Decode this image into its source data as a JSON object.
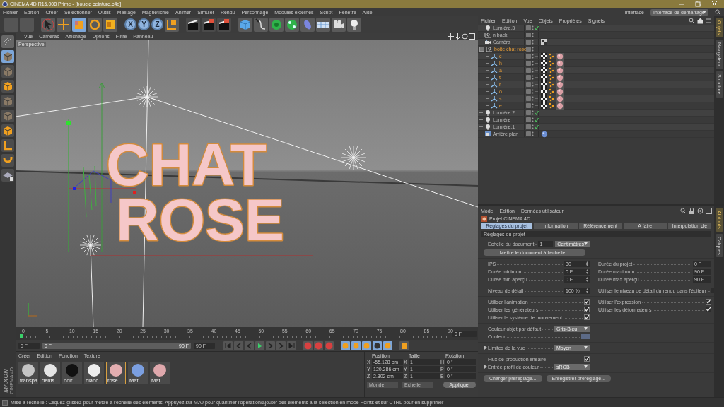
{
  "window": {
    "title": "CINEMA 4D R15.008 Prime - [boucle ceinture.c4d]"
  },
  "menu_bar": {
    "items": [
      "Fichier",
      "Edition",
      "Créer",
      "Sélectionner",
      "Outils",
      "Maillage",
      "Magnétisme",
      "Animer",
      "Simuler",
      "Rendu",
      "Personnage",
      "Modules externes",
      "Script",
      "Fenêtre",
      "Aide"
    ],
    "interface_label": "Interface",
    "interface_value": "Interface de démarrage"
  },
  "toolbar": {
    "tools": [
      {
        "selected": false
      },
      {
        "selected": false
      },
      {
        "selected": true
      },
      {
        "selected": false
      },
      {
        "selected": false
      }
    ],
    "axes": [
      {
        "label": "X"
      },
      {
        "label": "Y"
      },
      {
        "label": "Z"
      }
    ]
  },
  "viewport": {
    "menu": [
      "Vue",
      "Caméras",
      "Affichage",
      "Options",
      "Filtre",
      "Panneau"
    ],
    "camera_label": "Perspective",
    "scene_text": [
      "CHAT",
      "ROSE"
    ]
  },
  "timeline": {
    "ticks": [
      "0",
      "5",
      "10",
      "15",
      "20",
      "25",
      "30",
      "35",
      "40",
      "45",
      "50",
      "55",
      "60",
      "65",
      "70",
      "75",
      "80",
      "85",
      "90"
    ],
    "current_frame": "0 F"
  },
  "transport": {
    "start": "0 F",
    "range_start": "0 F",
    "range_end": "90 F",
    "end": "90 F",
    "level": 1
  },
  "materials": {
    "menu": [
      "Créer",
      "Edition",
      "Fonction",
      "Texture"
    ],
    "logo": [
      "MAXON",
      "CINEMA 4D"
    ],
    "items": [
      {
        "name": "transpa",
        "color": "#c4c4c4",
        "selected": false
      },
      {
        "name": "dents",
        "color": "#e6e6e6",
        "selected": false
      },
      {
        "name": "noir",
        "color": "#111111",
        "selected": false
      },
      {
        "name": "blanc",
        "color": "#eeeeee",
        "selected": false
      },
      {
        "name": "rose",
        "color": "#e3aeb0",
        "selected": true
      },
      {
        "name": "Mat",
        "color": "#7b9fe0",
        "selected": false
      },
      {
        "name": "Mat",
        "color": "#dfa8ac",
        "selected": false
      }
    ]
  },
  "coordinates": {
    "headers": [
      "Position",
      "Taille",
      "Rotation"
    ],
    "rows": [
      {
        "axis": "X",
        "position": "-55.128 cm",
        "size_axis": "X",
        "size": "1",
        "rot_axis": "H",
        "rotation": "0 °"
      },
      {
        "axis": "Y",
        "position": "120.286 cm",
        "size_axis": "Y",
        "size": "1",
        "rot_axis": "P",
        "rotation": "0 °"
      },
      {
        "axis": "Z",
        "position": "2.302 cm",
        "size_axis": "Z",
        "size": "1",
        "rot_axis": "B",
        "rotation": "0 °"
      }
    ],
    "space": "Monde",
    "mode": "Echelle",
    "apply": "Appliquer"
  },
  "object_manager": {
    "menu": [
      "Fichier",
      "Edition",
      "Vue",
      "Objets",
      "Propriétés",
      "Signets"
    ],
    "objects": [
      {
        "name": "Lumière.3",
        "kind": "light",
        "enabled": true,
        "selected": false
      },
      {
        "name": "n back",
        "kind": "null",
        "enabled": false,
        "selected": false
      },
      {
        "name": "Caméra",
        "kind": "camera",
        "enabled": false,
        "selected": false,
        "tags": [
          {
            "kind": "protection"
          }
        ]
      },
      {
        "name": "boite chat rose",
        "kind": "null",
        "enabled": false,
        "selected": true,
        "expanded": true,
        "children": [
          {
            "name": "c",
            "kind": "extrude",
            "enabled": false,
            "selected": true,
            "tags": [
              {
                "kind": "texture"
              },
              {
                "kind": "points"
              },
              {
                "kind": "material"
              }
            ]
          },
          {
            "name": "h",
            "kind": "extrude",
            "enabled": false,
            "selected": true,
            "tags": [
              {
                "kind": "texture"
              },
              {
                "kind": "points"
              },
              {
                "kind": "material"
              }
            ]
          },
          {
            "name": "a",
            "kind": "extrude",
            "enabled": false,
            "selected": true,
            "tags": [
              {
                "kind": "texture"
              },
              {
                "kind": "points"
              },
              {
                "kind": "material"
              }
            ]
          },
          {
            "name": "t",
            "kind": "extrude",
            "enabled": false,
            "selected": true,
            "tags": [
              {
                "kind": "texture"
              },
              {
                "kind": "points"
              },
              {
                "kind": "material"
              }
            ]
          },
          {
            "name": "r",
            "kind": "extrude",
            "enabled": false,
            "selected": true,
            "tags": [
              {
                "kind": "texture"
              },
              {
                "kind": "points"
              },
              {
                "kind": "material"
              }
            ]
          },
          {
            "name": "o",
            "kind": "extrude",
            "enabled": false,
            "selected": true,
            "tags": [
              {
                "kind": "texture"
              },
              {
                "kind": "points"
              },
              {
                "kind": "material"
              }
            ]
          },
          {
            "name": "s",
            "kind": "extrude",
            "enabled": false,
            "selected": true,
            "tags": [
              {
                "kind": "texture"
              },
              {
                "kind": "points"
              },
              {
                "kind": "material"
              }
            ]
          },
          {
            "name": "e",
            "kind": "extrude",
            "enabled": false,
            "selected": true,
            "tags": [
              {
                "kind": "texture"
              },
              {
                "kind": "points"
              },
              {
                "kind": "material"
              }
            ]
          }
        ]
      },
      {
        "name": "Lumière.2",
        "kind": "light",
        "enabled": true,
        "selected": false
      },
      {
        "name": "Lumière",
        "kind": "light",
        "enabled": true,
        "selected": false
      },
      {
        "name": "Lumière.1",
        "kind": "light",
        "enabled": true,
        "selected": false
      },
      {
        "name": "Arrière plan",
        "kind": "background",
        "enabled": false,
        "selected": false,
        "tags": [
          {
            "kind": "material_blue"
          }
        ]
      }
    ]
  },
  "side_tabs_top": [
    {
      "label": "Objets",
      "selected": true
    },
    {
      "label": "Navigateur",
      "selected": false
    },
    {
      "label": "Structure",
      "selected": false
    }
  ],
  "attributes": {
    "menu": [
      "Mode",
      "Edition",
      "Données utilisateur"
    ],
    "title": "Projet CINEMA 4D",
    "tabs": [
      {
        "label": "Réglages du projet",
        "selected": true
      },
      {
        "label": "Information",
        "selected": false
      },
      {
        "label": "Référencement",
        "selected": false
      },
      {
        "label": "A faire",
        "selected": false
      },
      {
        "label": "Interpolation clé",
        "selected": false
      }
    ],
    "section": "Réglages du projet",
    "groups": [
      {
        "left": [
          {
            "label": "Echelle du document",
            "kind": "number_unit",
            "value": "1",
            "unit": "Centimètres"
          }
        ],
        "button": "Mettre le document à l'échelle..."
      },
      {
        "left": [
          {
            "label": "IPS",
            "kind": "number",
            "value": "30"
          },
          {
            "label": "Durée minimum",
            "kind": "number",
            "value": "0 F"
          },
          {
            "label": "Durée min aperçu",
            "kind": "number",
            "value": "0 F"
          }
        ],
        "right": [
          {
            "label": "Durée du projet",
            "kind": "readout",
            "value": "0 F"
          },
          {
            "label": "Durée maximum",
            "kind": "readout",
            "value": "90 F"
          },
          {
            "label": "Durée max aperçu",
            "kind": "readout",
            "value": "90 F"
          }
        ]
      },
      {
        "left": [
          {
            "label": "Niveau de détail",
            "kind": "number",
            "value": "100 %"
          }
        ],
        "right": [
          {
            "label": "Utiliser le niveau de détail du rendu dans l'éditeur",
            "kind": "check",
            "checked": false
          }
        ]
      },
      {
        "left": [
          {
            "label": "Utiliser l'animation",
            "kind": "check",
            "checked": true
          },
          {
            "label": "Utiliser les générateurs",
            "kind": "check",
            "checked": true
          },
          {
            "label": "Utiliser le système de mouvement",
            "kind": "check",
            "checked": true
          }
        ],
        "right": [
          {
            "label": "Utiliser l'expression",
            "kind": "check",
            "checked": true
          },
          {
            "label": "Utiliser les déformateurs",
            "kind": "check",
            "checked": true
          }
        ]
      },
      {
        "left": [
          {
            "label": "Couleur objet par défaut",
            "kind": "dropdown",
            "value": "Gris-Bleu"
          },
          {
            "label": "Couleur",
            "kind": "color",
            "color": "#5c6a86"
          }
        ]
      },
      {
        "left": [
          {
            "label": "Limites de la vue",
            "kind": "dropdown",
            "value": "Moyen",
            "expanded": false
          }
        ]
      },
      {
        "left": [
          {
            "label": "Flux de production linéaire",
            "kind": "check",
            "checked": true
          },
          {
            "label": "Entrée profil de couleur",
            "kind": "dropdown",
            "value": "sRGB",
            "expanded": false
          }
        ]
      }
    ],
    "presets": [
      "Charger préréglage...",
      "Enregistrer préréglage..."
    ]
  },
  "side_tabs_bottom": [
    {
      "label": "Attributs",
      "selected": true
    },
    {
      "label": "Calques",
      "selected": false
    }
  ],
  "status_bar": "Mise à l'échelle : Cliquez-glissez pour mettre à l'échelle des éléments. Appuyez sur MAJ pour quantifier l'opération/ajouter des éléments à la sélection en mode Points et sur CTRL pour en supprimer"
}
